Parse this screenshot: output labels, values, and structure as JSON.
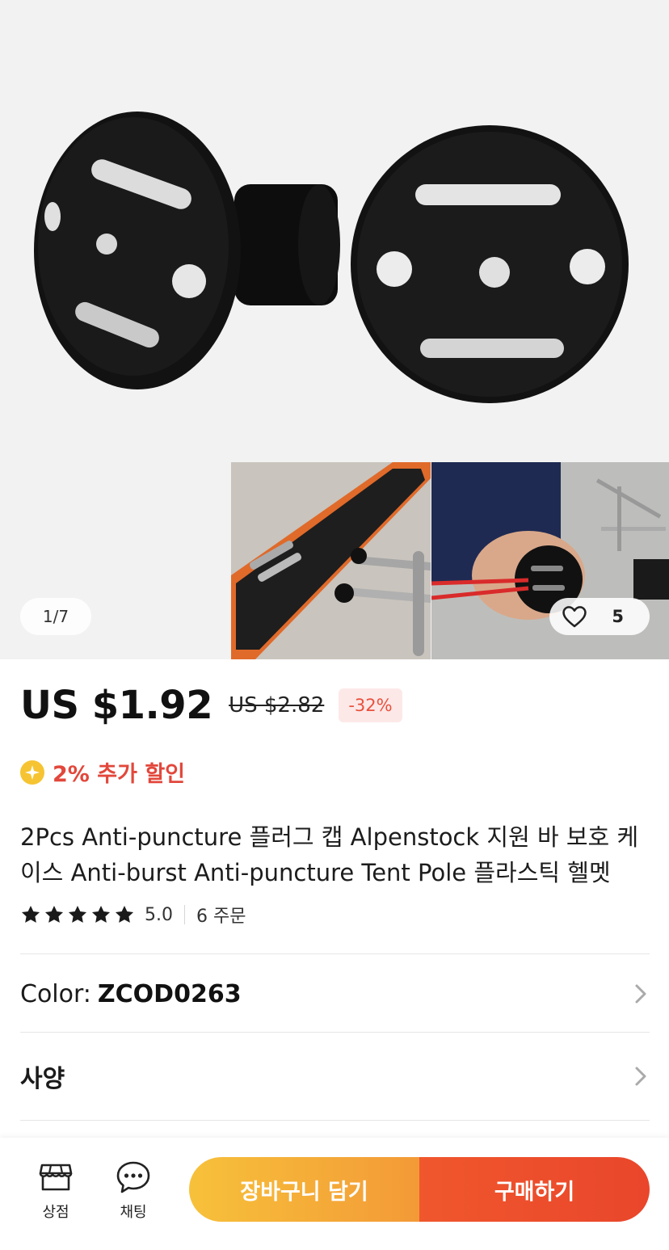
{
  "gallery": {
    "counter": "1/7",
    "wishlist_count": "5"
  },
  "price": {
    "current": "US $1.92",
    "original": "US $2.82",
    "discount": "-32%"
  },
  "coin_discount": "2% 추가 할인",
  "product": {
    "title": "2Pcs Anti-puncture 플러그 캡 Alpenstock 지원 바 보호 케이스 Anti-burst Anti-puncture Tent Pole 플라스틱 헬멧",
    "rating": "5.0",
    "stars": 5,
    "orders": "6 주문"
  },
  "options": {
    "color_label": "Color:",
    "color_value": "ZCOD0263",
    "spec_label": "사양"
  },
  "bottom_bar": {
    "store_label": "상점",
    "chat_label": "채팅",
    "cart_button": "장바구니 담기",
    "buy_button": "구매하기"
  },
  "colors": {
    "price_red": "#e2473b",
    "cart_gradient_start": "#f7c13a",
    "buy_gradient_end": "#e9462b"
  },
  "icons": [
    "heart-icon",
    "coin-icon",
    "star-icon",
    "chevron-right-icon",
    "store-icon",
    "chat-icon"
  ]
}
